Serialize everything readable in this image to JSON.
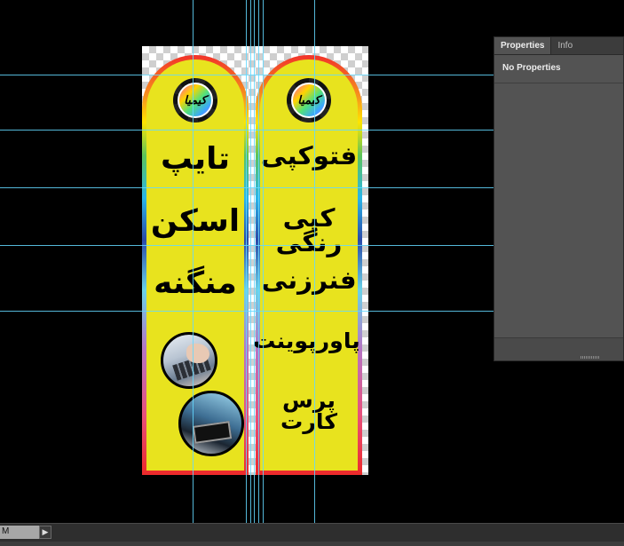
{
  "panel": {
    "tabs": [
      {
        "label": "Properties",
        "active": true
      },
      {
        "label": "Info",
        "active": false
      }
    ],
    "message": "No Properties"
  },
  "statusbar": {
    "zoom_value": "M",
    "arrow": "▶"
  },
  "document": {
    "left_banner": {
      "seal_text": "کیمیا",
      "words": [
        "تایپ",
        "اسکن",
        "منگنه"
      ]
    },
    "right_banner": {
      "seal_text": "کیمیا",
      "words": [
        "فتوکپی",
        "کپی رنگی",
        "فنرزنی",
        "پاورپوینت",
        "پرس کارت"
      ]
    }
  },
  "colors": {
    "banner_fill": "#e8e31e",
    "guide": "#63d8ff",
    "panel_bg": "#535353",
    "canvas_bg": "#000000"
  }
}
